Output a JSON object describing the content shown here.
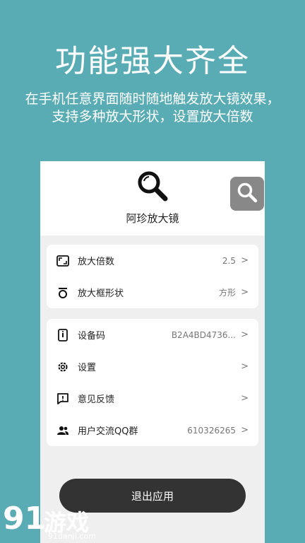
{
  "headline": "功能强大齐全",
  "subline": "在手机任意界面随时随地触发放大镜效果，支持多种放大形状，设置放大倍数",
  "app": {
    "name": "阿珍放大镜",
    "icon": "magnifier-icon"
  },
  "float_button": {
    "icon": "magnifier-icon"
  },
  "settings_group_1": [
    {
      "label": "放大倍数",
      "value": "2.5",
      "icon": "zoom-frame-icon"
    },
    {
      "label": "放大框形状",
      "value": "方形",
      "icon": "shape-icon"
    }
  ],
  "settings_group_2": [
    {
      "label": "设备码",
      "value": "B2A4BD4736...",
      "icon": "phone-info-icon"
    },
    {
      "label": "设置",
      "value": "",
      "icon": "gear-icon"
    },
    {
      "label": "意见反馈",
      "value": "",
      "icon": "feedback-icon"
    },
    {
      "label": "用户交流QQ群",
      "value": "610326265",
      "icon": "group-icon"
    }
  ],
  "logout_label": "退出应用",
  "chevron": ">",
  "watermark": {
    "digits": "91",
    "text": "游戏",
    "url": "91danji.com"
  }
}
